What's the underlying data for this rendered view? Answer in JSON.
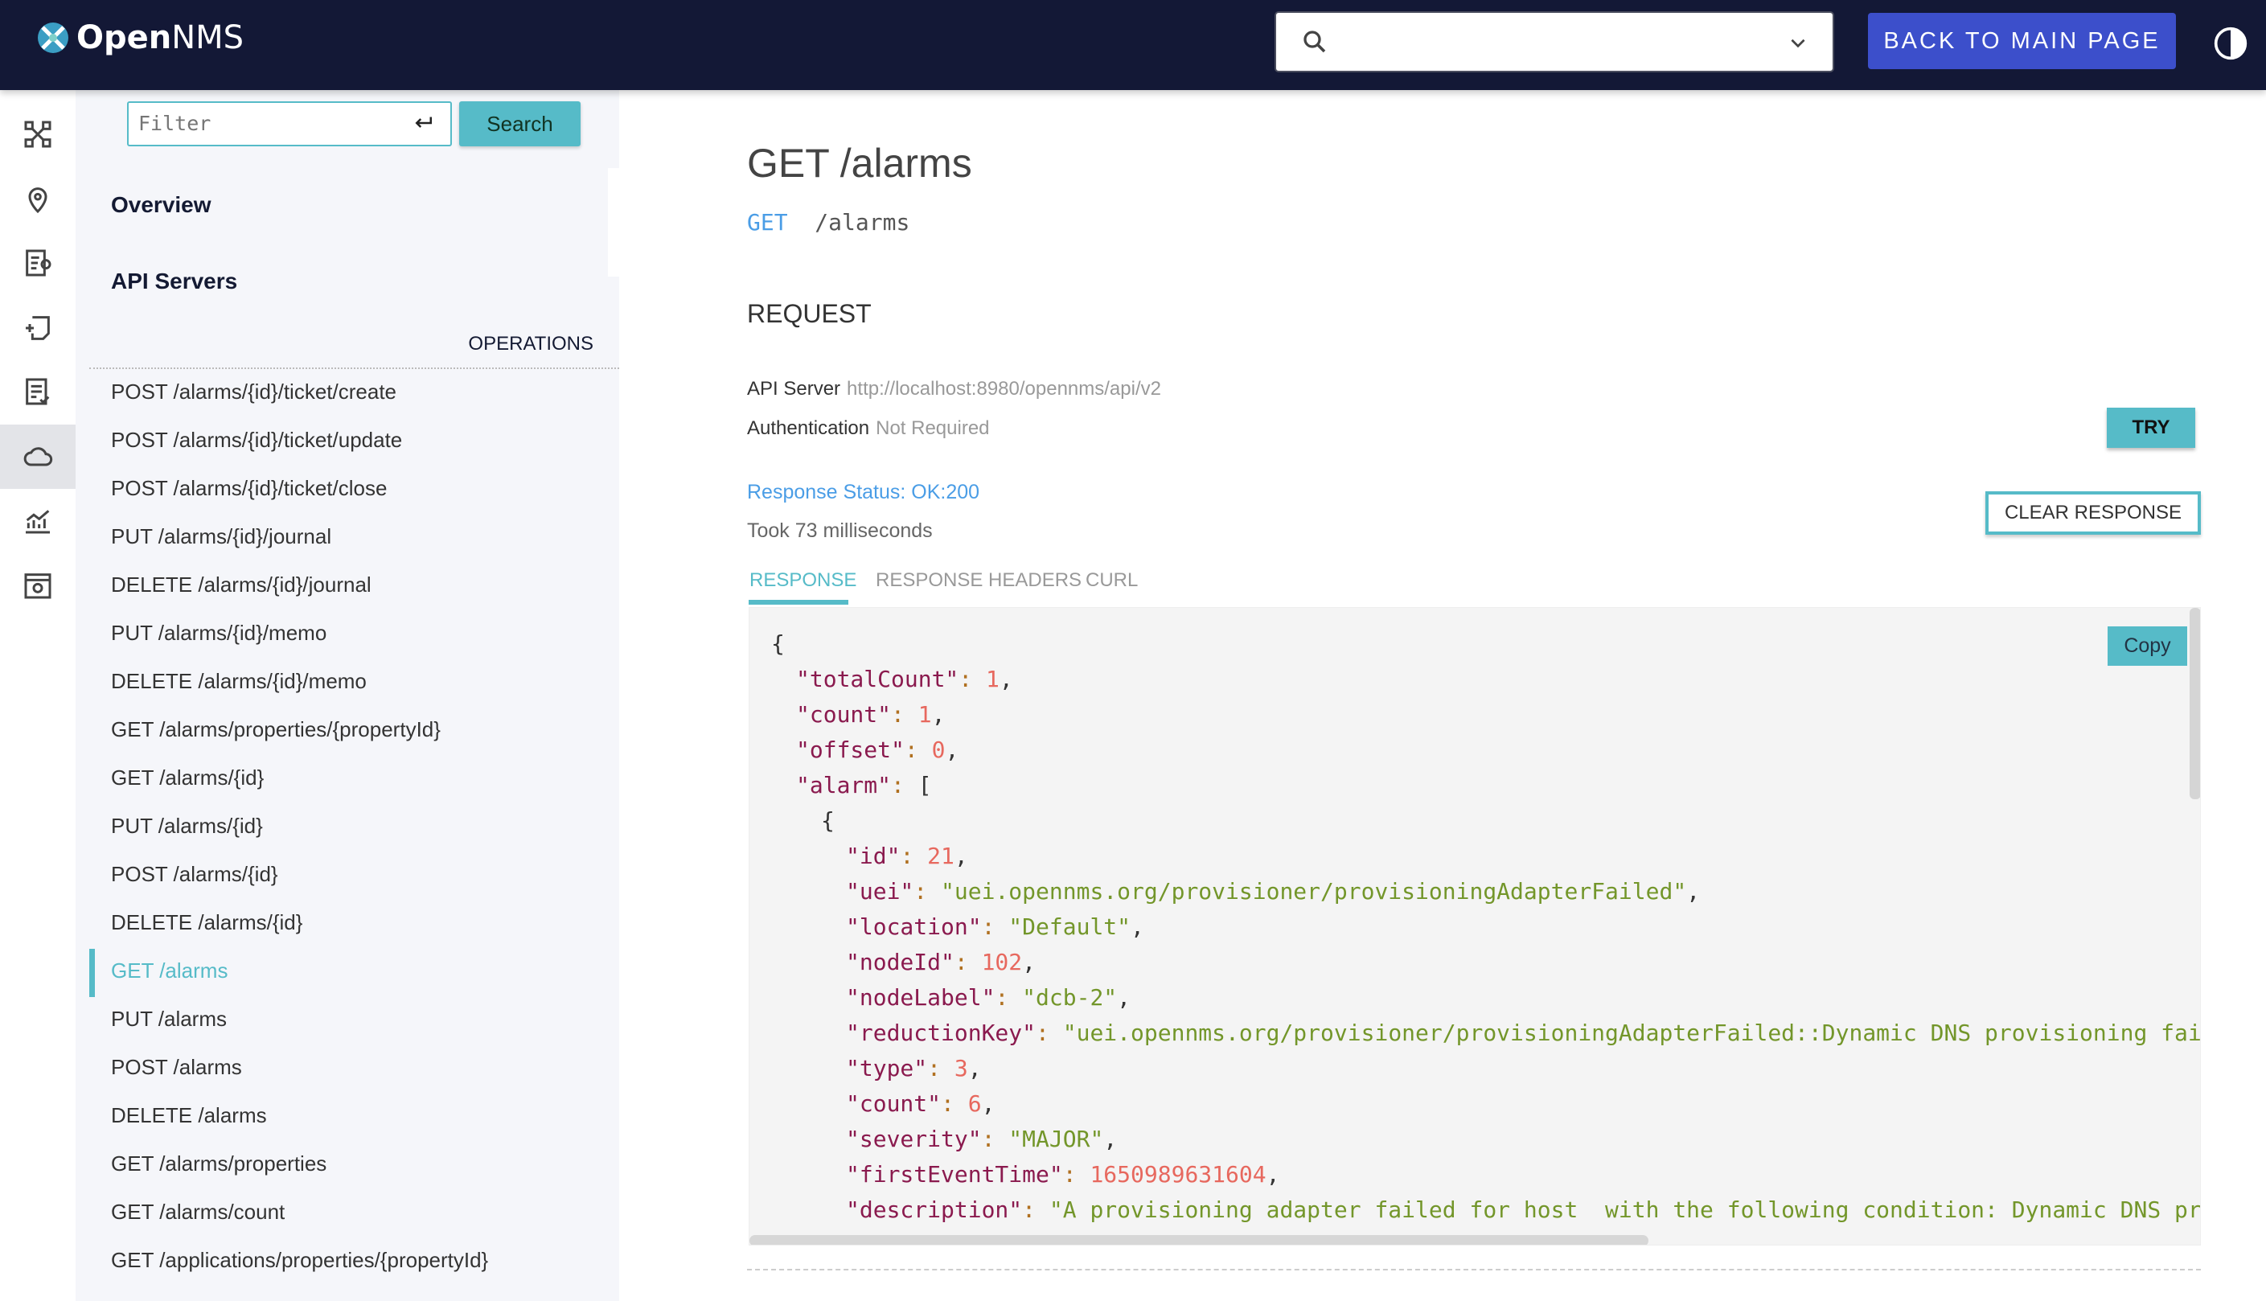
{
  "header": {
    "logo_text_bold": "Open",
    "logo_text": "NMS",
    "back_label": "BACK TO MAIN PAGE",
    "search_value": ""
  },
  "rail": {
    "icons": [
      "network-topology-icon",
      "map-pin-icon",
      "config-list-icon",
      "add-device-icon",
      "checklist-icon",
      "cloud-icon",
      "chart-icon",
      "settings-window-icon"
    ],
    "active_index": 5
  },
  "sidebar": {
    "filter_placeholder": "Filter",
    "search_label": "Search",
    "overview": "Overview",
    "api_servers": "API Servers",
    "operations": "OPERATIONS",
    "items": [
      "POST /alarms/{id}/ticket/create",
      "POST /alarms/{id}/ticket/update",
      "POST /alarms/{id}/ticket/close",
      "PUT /alarms/{id}/journal",
      "DELETE /alarms/{id}/journal",
      "PUT /alarms/{id}/memo",
      "DELETE /alarms/{id}/memo",
      "GET /alarms/properties/{propertyId}",
      "GET /alarms/{id}",
      "PUT /alarms/{id}",
      "POST /alarms/{id}",
      "DELETE /alarms/{id}",
      "GET /alarms",
      "PUT /alarms",
      "POST /alarms",
      "DELETE /alarms",
      "GET /alarms/properties",
      "GET /alarms/count",
      "GET /applications/properties/{propertyId}"
    ],
    "active_index": 12
  },
  "main": {
    "title": "GET /alarms",
    "method": "GET",
    "path": "/alarms",
    "request": "REQUEST",
    "api_server_label": "API Server",
    "api_server_value": "http://localhost:8980/opennms/api/v2",
    "auth_label": "Authentication",
    "auth_value": "Not Required",
    "try_label": "TRY",
    "status": "Response Status: OK:200",
    "took": "Took 73 milliseconds",
    "clear_label": "CLEAR RESPONSE",
    "tabs": [
      "RESPONSE",
      "RESPONSE HEADERS",
      "CURL"
    ],
    "active_tab": 0,
    "copy_label": "Copy",
    "code_lines": [
      [
        0,
        "",
        "{",
        "",
        ""
      ],
      [
        1,
        "\"totalCount\"",
        "1",
        "n",
        ","
      ],
      [
        1,
        "\"count\"",
        "1",
        "n",
        ","
      ],
      [
        1,
        "\"offset\"",
        "0",
        "n",
        ","
      ],
      [
        1,
        "\"alarm\"",
        "[",
        "",
        ""
      ],
      [
        2,
        "",
        "{",
        "",
        ""
      ],
      [
        3,
        "\"id\"",
        "21",
        "n",
        ","
      ],
      [
        3,
        "\"uei\"",
        "\"uei.opennms.org/provisioner/provisioningAdapterFailed\"",
        "s",
        ","
      ],
      [
        3,
        "\"location\"",
        "\"Default\"",
        "s",
        ","
      ],
      [
        3,
        "\"nodeId\"",
        "102",
        "n",
        ","
      ],
      [
        3,
        "\"nodeLabel\"",
        "\"dcb-2\"",
        "s",
        ","
      ],
      [
        3,
        "\"reductionKey\"",
        "\"uei.opennms.org/provisioner/provisioningAdapterFailed::Dynamic DNS provisioning failed: org",
        "s",
        ""
      ],
      [
        3,
        "\"type\"",
        "3",
        "n",
        ","
      ],
      [
        3,
        "\"count\"",
        "6",
        "n",
        ","
      ],
      [
        3,
        "\"severity\"",
        "\"MAJOR\"",
        "s",
        ","
      ],
      [
        3,
        "\"firstEventTime\"",
        "1650989631604",
        "n",
        ","
      ],
      [
        3,
        "\"description\"",
        "\"A provisioning adapter failed for host  with the following condition: Dynamic DNS provisioning",
        "s",
        ""
      ]
    ]
  },
  "colors": {
    "header_bg": "#131836",
    "accent": "#56bbc8",
    "back_button": "#3c4fcb",
    "link_blue": "#4a9de6",
    "json_key": "#8a1a4e",
    "json_string": "#73962a",
    "json_number": "#e7685e"
  }
}
